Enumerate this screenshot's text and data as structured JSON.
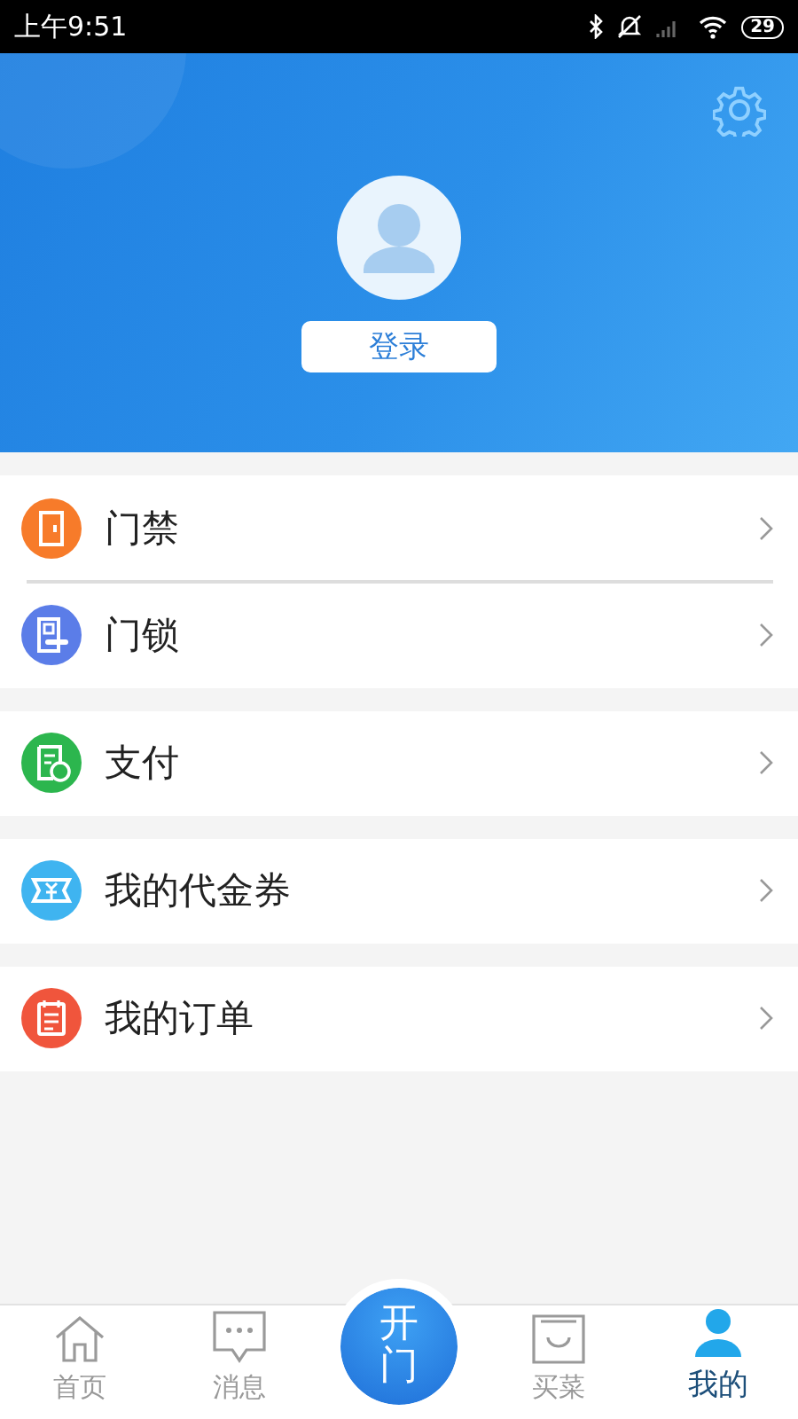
{
  "status_bar": {
    "time": "上午9:51",
    "battery": "29"
  },
  "header": {
    "login_button": "登录"
  },
  "menu_groups": [
    {
      "items": [
        {
          "label": "门禁",
          "kind": "door",
          "color": "#f77b2a"
        },
        {
          "label": "门锁",
          "kind": "lock",
          "color": "#5b7de8"
        }
      ]
    },
    {
      "items": [
        {
          "label": "支付",
          "kind": "payment",
          "color": "#2cb64e"
        }
      ]
    },
    {
      "items": [
        {
          "label": "我的代金券",
          "kind": "voucher",
          "color": "#3fb4f0"
        }
      ]
    },
    {
      "items": [
        {
          "label": "我的订单",
          "kind": "order",
          "color": "#f0553c"
        }
      ]
    }
  ],
  "tab_bar": [
    {
      "label": "首页",
      "kind": "home",
      "selected": false
    },
    {
      "label": "消息",
      "kind": "message",
      "selected": false
    },
    {
      "label": "开门",
      "kind": "center",
      "selected": false
    },
    {
      "label": "买菜",
      "kind": "shop",
      "selected": false
    },
    {
      "label": "我的",
      "kind": "profile",
      "selected": true
    }
  ]
}
